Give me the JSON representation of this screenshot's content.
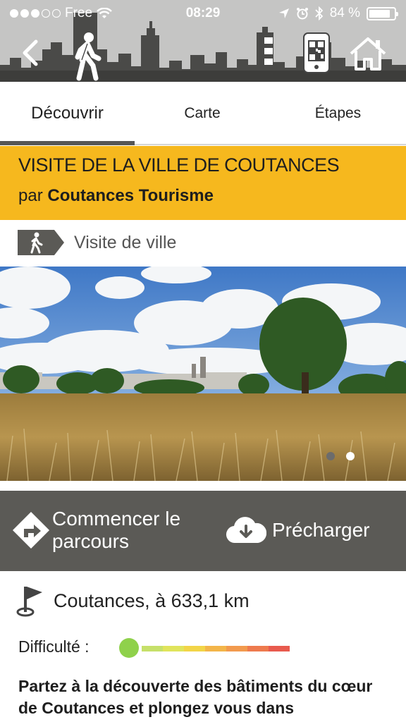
{
  "status_bar": {
    "carrier": "Free",
    "signal_dots_filled": 3,
    "signal_dots_total": 5,
    "time": "08:29",
    "battery": "84 %",
    "battery_level": 0.84
  },
  "header": {
    "back_icon": "chevron-left-icon",
    "mode_icon": "walking-person-icon",
    "menu_icon": "vertical-dots-icon",
    "qr_icon": "qr-phone-icon",
    "home_icon": "home-icon"
  },
  "tabs": [
    {
      "label": "Découvrir",
      "active": true
    },
    {
      "label": "Carte",
      "active": false
    },
    {
      "label": "Étapes",
      "active": false
    }
  ],
  "tour": {
    "title": "VISITE DE LA VILLE DE COUTANCES",
    "author_prefix": "par",
    "author": "Coutances Tourisme",
    "category": "Visite de ville"
  },
  "gallery": {
    "count": 2,
    "current": 2
  },
  "actions": {
    "start_line1": "Commencer le",
    "start_line2": "parcours",
    "preload": "Précharger"
  },
  "details": {
    "location": "Coutances, à 633,1 km",
    "difficulty_label": "Difficulté :",
    "difficulty_level": 0,
    "description": "Partez à la découverte des bâtiments du cœur de Coutances et plongez vous dans"
  },
  "colors": {
    "header_bg": "#c5c5c4",
    "skyline": "#4a4a48",
    "title_band": "#f6b81e",
    "actions_bg": "#5b5a56",
    "difficulty_knob": "#8fd14b"
  }
}
